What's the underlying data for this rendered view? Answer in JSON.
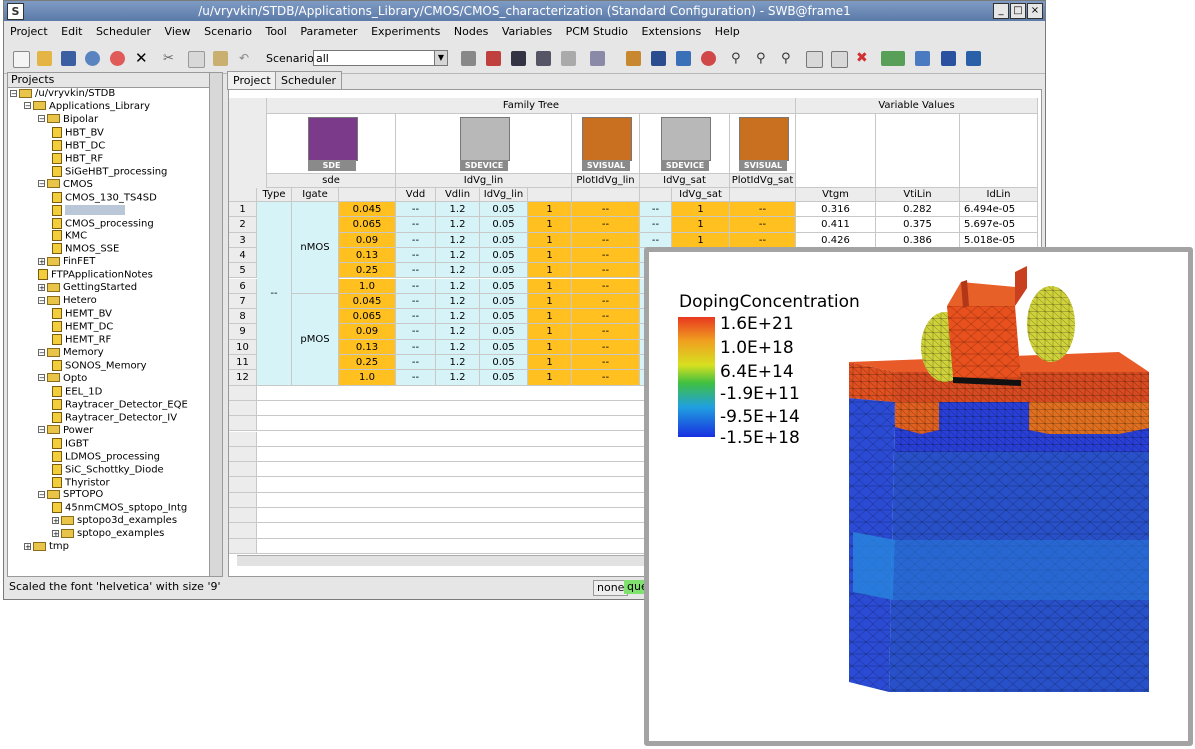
{
  "window": {
    "title": "/u/vryvkin/STDB/Applications_Library/CMOS/CMOS_characterization (Standard Configuration) - SWB@frame1",
    "sys_icon": "S",
    "buttons": {
      "minimize": "_",
      "maximize": "□",
      "close": "×"
    }
  },
  "menu": [
    "Project",
    "Edit",
    "Scheduler",
    "View",
    "Scenario",
    "Tool",
    "Parameter",
    "Experiments",
    "Nodes",
    "Variables",
    "PCM Studio",
    "Extensions",
    "Help"
  ],
  "toolbar": {
    "scenario_label": "Scenario:",
    "scenario_value": "all",
    "arrow": "▼"
  },
  "projects": {
    "header": "Projects",
    "tree": [
      {
        "depth": 0,
        "type": "folder",
        "exp": "−",
        "label": "/u/vryvkin/STDB"
      },
      {
        "depth": 1,
        "type": "folder",
        "exp": "−",
        "label": "Applications_Library"
      },
      {
        "depth": 2,
        "type": "folder",
        "exp": "−",
        "label": "Bipolar"
      },
      {
        "depth": 3,
        "type": "doc",
        "label": "HBT_BV"
      },
      {
        "depth": 3,
        "type": "doc",
        "label": "HBT_DC"
      },
      {
        "depth": 3,
        "type": "doc",
        "label": "HBT_RF"
      },
      {
        "depth": 3,
        "type": "doc",
        "label": "SiGeHBT_processing"
      },
      {
        "depth": 2,
        "type": "folder",
        "exp": "−",
        "label": "CMOS"
      },
      {
        "depth": 3,
        "type": "doc",
        "label": "CMOS_130_TS4SD"
      },
      {
        "depth": 3,
        "type": "doc",
        "label": "",
        "selected": true
      },
      {
        "depth": 3,
        "type": "doc",
        "label": "CMOS_processing"
      },
      {
        "depth": 3,
        "type": "doc",
        "label": "KMC"
      },
      {
        "depth": 3,
        "type": "doc",
        "label": "NMOS_SSE"
      },
      {
        "depth": 2,
        "type": "folder",
        "exp": "+",
        "label": "FinFET"
      },
      {
        "depth": 2,
        "type": "doc",
        "label": "FTPApplicationNotes"
      },
      {
        "depth": 2,
        "type": "folder",
        "exp": "+",
        "label": "GettingStarted"
      },
      {
        "depth": 2,
        "type": "folder",
        "exp": "−",
        "label": "Hetero"
      },
      {
        "depth": 3,
        "type": "doc",
        "label": "HEMT_BV"
      },
      {
        "depth": 3,
        "type": "doc",
        "label": "HEMT_DC"
      },
      {
        "depth": 3,
        "type": "doc",
        "label": "HEMT_RF"
      },
      {
        "depth": 2,
        "type": "folder",
        "exp": "−",
        "label": "Memory"
      },
      {
        "depth": 3,
        "type": "doc",
        "label": "SONOS_Memory"
      },
      {
        "depth": 2,
        "type": "folder",
        "exp": "−",
        "label": "Opto"
      },
      {
        "depth": 3,
        "type": "doc",
        "label": "EEL_1D"
      },
      {
        "depth": 3,
        "type": "doc",
        "label": "Raytracer_Detector_EQE"
      },
      {
        "depth": 3,
        "type": "doc",
        "label": "Raytracer_Detector_IV"
      },
      {
        "depth": 2,
        "type": "folder",
        "exp": "−",
        "label": "Power"
      },
      {
        "depth": 3,
        "type": "doc",
        "label": "IGBT"
      },
      {
        "depth": 3,
        "type": "doc",
        "label": "LDMOS_processing"
      },
      {
        "depth": 3,
        "type": "doc",
        "label": "SiC_Schottky_Diode"
      },
      {
        "depth": 3,
        "type": "doc",
        "label": "Thyristor"
      },
      {
        "depth": 2,
        "type": "folder",
        "exp": "−",
        "label": "SPTOPO"
      },
      {
        "depth": 3,
        "type": "doc",
        "label": "45nmCMOS_sptopo_Intg"
      },
      {
        "depth": 3,
        "type": "folder",
        "exp": "+",
        "label": "sptopo3d_examples"
      },
      {
        "depth": 3,
        "type": "folder",
        "exp": "+",
        "label": "sptopo_examples"
      },
      {
        "depth": 1,
        "type": "folder",
        "exp": "+",
        "label": "tmp"
      }
    ]
  },
  "tabs": [
    "Project",
    "Scheduler"
  ],
  "table": {
    "family_tree": "Family Tree",
    "variable_values": "Variable Values",
    "tools": [
      {
        "name": "SDE",
        "icon": "sde-tool-icon"
      },
      {
        "name": "SDEVICE",
        "icon": "sdevice-tool-icon"
      },
      {
        "name": "SVISUAL",
        "icon": "svisual-tool-icon"
      },
      {
        "name": "SDEVICE",
        "icon": "sdevice-tool-icon"
      },
      {
        "name": "SVISUAL",
        "icon": "svisual-tool-icon"
      }
    ],
    "steps": [
      "sde",
      "IdVg_lin",
      "PlotIdVg_lin",
      "IdVg_sat",
      "PlotIdVg_sat"
    ],
    "params": [
      "Type",
      "Igate",
      "Vdd",
      "Vdlin",
      "IdVg_lin",
      "IdVg_sat"
    ],
    "var_headers": [
      "Vtgm",
      "VtiLin",
      "IdLin"
    ],
    "group_label": "--",
    "types": [
      "nMOS",
      "pMOS"
    ],
    "rows": [
      {
        "n": "1",
        "igate": "0.045",
        "vdd": "1.2",
        "vdlin": "0.05",
        "lin": "1",
        "plot": "--",
        "sat": "1",
        "plotsat": "--",
        "d1": "--",
        "d2": "--",
        "d3": "--"
      },
      {
        "n": "2",
        "igate": "0.065",
        "vdd": "1.2",
        "vdlin": "0.05",
        "lin": "1",
        "plot": "--",
        "sat": "1",
        "plotsat": "--",
        "d1": "--",
        "d2": "--",
        "d3": "--"
      },
      {
        "n": "3",
        "igate": "0.09",
        "vdd": "1.2",
        "vdlin": "0.05",
        "lin": "1",
        "plot": "--",
        "sat": "1",
        "plotsat": "--",
        "d1": "--",
        "d2": "--",
        "d3": "--"
      },
      {
        "n": "4",
        "igate": "0.13",
        "vdd": "1.2",
        "vdlin": "0.05",
        "lin": "1",
        "plot": "--",
        "sat": "",
        "plotsat": "",
        "d1": "--",
        "d2": "--",
        "d3": ""
      },
      {
        "n": "5",
        "igate": "0.25",
        "vdd": "1.2",
        "vdlin": "0.05",
        "lin": "1",
        "plot": "--",
        "sat": "",
        "plotsat": "",
        "d1": "--",
        "d2": "--",
        "d3": ""
      },
      {
        "n": "6",
        "igate": "1.0",
        "vdd": "1.2",
        "vdlin": "0.05",
        "lin": "1",
        "plot": "--",
        "sat": "",
        "plotsat": "",
        "d1": "--",
        "d2": "--",
        "d3": ""
      },
      {
        "n": "7",
        "igate": "0.045",
        "vdd": "1.2",
        "vdlin": "0.05",
        "lin": "1",
        "plot": "--",
        "sat": "",
        "plotsat": "",
        "d1": "--",
        "d2": "--",
        "d3": ""
      },
      {
        "n": "8",
        "igate": "0.065",
        "vdd": "1.2",
        "vdlin": "0.05",
        "lin": "1",
        "plot": "--",
        "sat": "",
        "plotsat": "",
        "d1": "--",
        "d2": "--",
        "d3": ""
      },
      {
        "n": "9",
        "igate": "0.09",
        "vdd": "1.2",
        "vdlin": "0.05",
        "lin": "1",
        "plot": "--",
        "sat": "",
        "plotsat": "",
        "d1": "--",
        "d2": "--",
        "d3": ""
      },
      {
        "n": "10",
        "igate": "0.13",
        "vdd": "1.2",
        "vdlin": "0.05",
        "lin": "1",
        "plot": "--",
        "sat": "",
        "plotsat": "",
        "d1": "--",
        "d2": "--",
        "d3": ""
      },
      {
        "n": "11",
        "igate": "0.25",
        "vdd": "1.2",
        "vdlin": "0.05",
        "lin": "1",
        "plot": "--",
        "sat": "",
        "plotsat": "",
        "d1": "--",
        "d2": "--",
        "d3": ""
      },
      {
        "n": "12",
        "igate": "1.0",
        "vdd": "1.2",
        "vdlin": "0.05",
        "lin": "1",
        "plot": "--",
        "sat": "",
        "plotsat": "",
        "d1": "--",
        "d2": "--",
        "d3": ""
      }
    ],
    "var_rows": [
      {
        "vtgm": "0.316",
        "vtilin": "0.282",
        "idlin": "6.494e-05"
      },
      {
        "vtgm": "0.411",
        "vtilin": "0.375",
        "idlin": "5.697e-05"
      },
      {
        "vtgm": "0.426",
        "vtilin": "0.386",
        "idlin": "5.018e-05"
      }
    ]
  },
  "status": {
    "message": "Scaled the font 'helvetica' with size '9'",
    "none_label": "none",
    "queue_label": "que"
  },
  "plot": {
    "legend_title": "DopingConcentration",
    "legend_labels": [
      "1.6E+21",
      "1.0E+18",
      "6.4E+14",
      "-1.9E+11",
      "-9.5E+14",
      "-1.5E+18"
    ],
    "legend_colors": [
      "#e83820",
      "#f0a020",
      "#d8e020",
      "#40c040",
      "#20a0e0",
      "#1830e0"
    ]
  },
  "colors": {
    "titlebar": "#6a88b8",
    "highlight": "#ffc020",
    "light_cyan": "#d6f4f8",
    "accent_green": "#80e070"
  }
}
